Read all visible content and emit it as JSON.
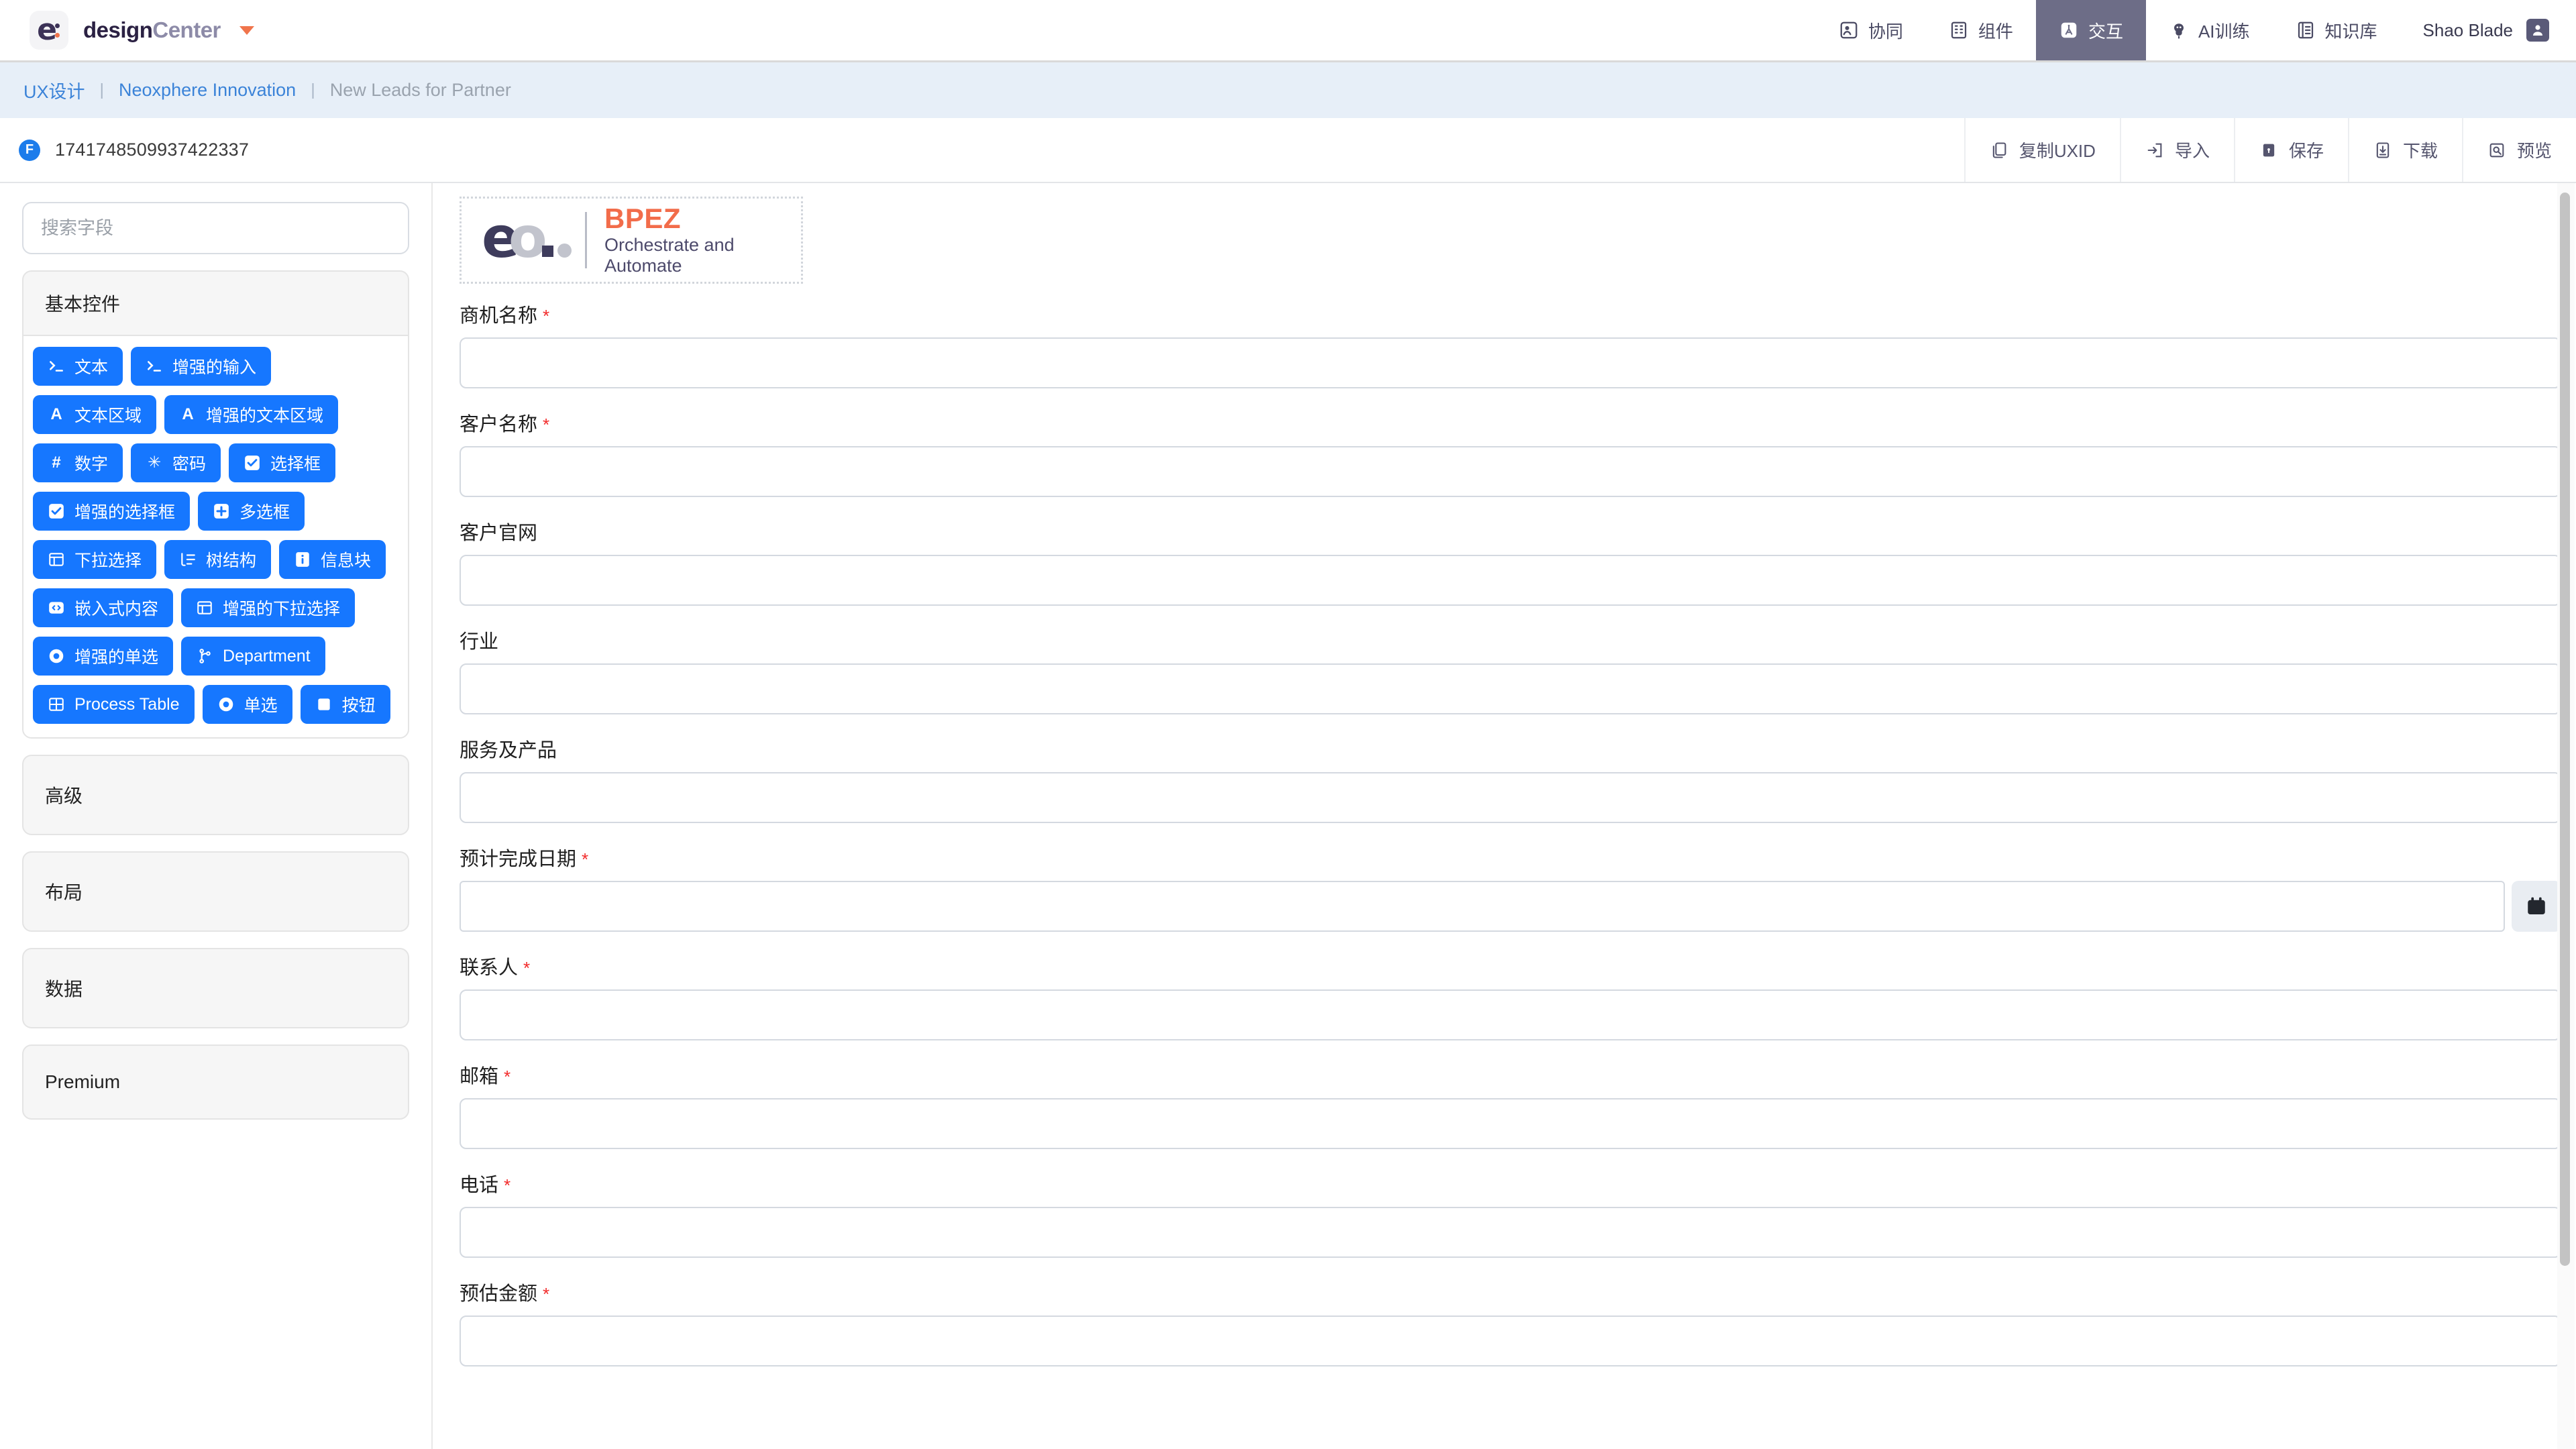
{
  "header": {
    "brand_primary": "design",
    "brand_secondary": "Center",
    "brand_caret_icon": "caret-down-icon",
    "nav": [
      {
        "label": "协同",
        "icon": "collaborate-icon",
        "active": false
      },
      {
        "label": "组件",
        "icon": "components-grid-icon",
        "active": false
      },
      {
        "label": "交互",
        "icon": "interaction-icon",
        "active": true
      },
      {
        "label": "AI训练",
        "icon": "ai-brain-icon",
        "active": false
      },
      {
        "label": "知识库",
        "icon": "knowledge-book-icon",
        "active": false
      }
    ],
    "user_name": "Shao Blade",
    "user_icon": "user-avatar-icon",
    "active_tab_color": "#6d6d87"
  },
  "breadcrumb": {
    "items": [
      "UX设计",
      "Neoxphere Innovation",
      "New Leads for Partner"
    ],
    "separator": "|",
    "link_color": "#3b83d8",
    "current_color": "#9aa3ae",
    "background": "#e7eff8"
  },
  "uxbar": {
    "badge_letter": "F",
    "badge_color": "#1c7ceb",
    "uxid": "1741748509937422337",
    "tools": [
      {
        "label": "复制UXID",
        "icon": "copy-icon"
      },
      {
        "label": "导入",
        "icon": "import-icon"
      },
      {
        "label": "保存",
        "icon": "save-lock-icon"
      },
      {
        "label": "下载",
        "icon": "download-icon"
      },
      {
        "label": "预览",
        "icon": "preview-eye-icon"
      }
    ]
  },
  "sidebar": {
    "search_placeholder": "搜索字段",
    "search_value": "",
    "panels": [
      {
        "title": "基本控件",
        "expanded": true,
        "chips": [
          {
            "label": "文本",
            "icon": "terminal-icon"
          },
          {
            "label": "增强的输入",
            "icon": "terminal-icon"
          },
          {
            "label": "文本区域",
            "icon": "letter-a-icon"
          },
          {
            "label": "增强的文本区域",
            "icon": "letter-a-icon"
          },
          {
            "label": "数字",
            "icon": "hash-icon"
          },
          {
            "label": "密码",
            "icon": "asterisk-icon"
          },
          {
            "label": "选择框",
            "icon": "checkbox-icon"
          },
          {
            "label": "增强的选择框",
            "icon": "checkbox-icon"
          },
          {
            "label": "多选框",
            "icon": "plus-box-icon"
          },
          {
            "label": "下拉选择",
            "icon": "list-table-icon"
          },
          {
            "label": "树结构",
            "icon": "tree-icon"
          },
          {
            "label": "信息块",
            "icon": "info-icon"
          },
          {
            "label": "嵌入式内容",
            "icon": "code-embed-icon"
          },
          {
            "label": "增强的下拉选择",
            "icon": "list-table-icon"
          },
          {
            "label": "增强的单选",
            "icon": "radio-icon"
          },
          {
            "label": "Department",
            "icon": "branch-icon"
          },
          {
            "label": "Process Table",
            "icon": "grid-table-icon"
          },
          {
            "label": "单选",
            "icon": "radio-icon"
          },
          {
            "label": "按钮",
            "icon": "square-button-icon"
          }
        ]
      },
      {
        "title": "高级",
        "expanded": false,
        "chips": []
      },
      {
        "title": "布局",
        "expanded": false,
        "chips": []
      },
      {
        "title": "数据",
        "expanded": false,
        "chips": []
      },
      {
        "title": "Premium",
        "expanded": false,
        "chips": []
      }
    ],
    "chip_color": "#1677ff"
  },
  "canvas": {
    "logo": {
      "mark_left": "e",
      "mark_right": "o",
      "title": "BPEZ",
      "subtitle": "Orchestrate and Automate",
      "title_color": "#f26c4a",
      "subtitle_color": "#4d4a6b"
    },
    "fields": [
      {
        "label": "商机名称",
        "required": true,
        "value": "",
        "type": "text"
      },
      {
        "label": "客户名称",
        "required": true,
        "value": "",
        "type": "text"
      },
      {
        "label": "客户官网",
        "required": false,
        "value": "",
        "type": "text"
      },
      {
        "label": "行业",
        "required": false,
        "value": "",
        "type": "text"
      },
      {
        "label": "服务及产品",
        "required": false,
        "value": "",
        "type": "text"
      },
      {
        "label": "预计完成日期",
        "required": true,
        "value": "",
        "type": "date",
        "icon": "calendar-icon"
      },
      {
        "label": "联系人",
        "required": true,
        "value": "",
        "type": "text"
      },
      {
        "label": "邮箱",
        "required": true,
        "value": "",
        "type": "text"
      },
      {
        "label": "电话",
        "required": true,
        "value": "",
        "type": "text"
      },
      {
        "label": "预估金额",
        "required": true,
        "value": "",
        "type": "text"
      }
    ],
    "required_marker": "*"
  }
}
